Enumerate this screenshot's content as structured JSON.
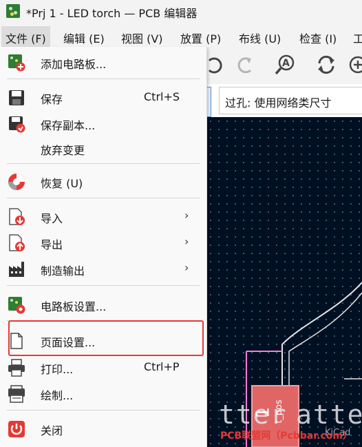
{
  "window": {
    "title": "*Prj 1 - LED torch — PCB 编辑器"
  },
  "menubar": {
    "items": [
      {
        "label": "文件 (F)"
      },
      {
        "label": "编辑 (E)"
      },
      {
        "label": "视图 (V)"
      },
      {
        "label": "放置 (P)"
      },
      {
        "label": "布线 (U)"
      },
      {
        "label": "检查 (I)"
      },
      {
        "label": "工"
      }
    ]
  },
  "toolbar": {
    "via_size_label": "过孔: 使用网络类尺寸"
  },
  "file_menu": {
    "items": [
      {
        "label": "添加电路板...",
        "icon": "add-board-icon"
      },
      {
        "label": "保存",
        "shortcut": "Ctrl+S",
        "icon": "save-icon"
      },
      {
        "label": "保存副本...",
        "icon": "save-copy-icon"
      },
      {
        "label": "放弃变更"
      },
      {
        "label": "恢复 (U)",
        "icon": "revert-icon"
      },
      {
        "label": "导入",
        "icon": "import-icon",
        "submenu": "›"
      },
      {
        "label": "导出",
        "icon": "export-icon",
        "submenu": "›"
      },
      {
        "label": "制造输出",
        "icon": "fabrication-icon",
        "submenu": "›"
      },
      {
        "label": "电路板设置...",
        "icon": "board-setup-icon"
      },
      {
        "label": "页面设置...",
        "icon": "page-settings-icon"
      },
      {
        "label": "打印...",
        "shortcut": "Ctrl+P",
        "icon": "print-icon"
      },
      {
        "label": "绘制...",
        "icon": "plot-icon"
      },
      {
        "label": "关闭",
        "icon": "close-icon"
      }
    ]
  },
  "canvas": {
    "silk_text_1": "tter",
    "silk_text_2": "atte",
    "pad_ref": "1",
    "pad_label": "t_pos"
  },
  "watermark": {
    "text": "PCB联盟网（Pcbbar.com）",
    "kicad": "KiCad"
  },
  "colors": {
    "accent_red": "#e53935",
    "canvas_bg": "#001023",
    "pad": "#e06666",
    "silk": "#e6e6e6",
    "outline": "#ff7ad9"
  }
}
